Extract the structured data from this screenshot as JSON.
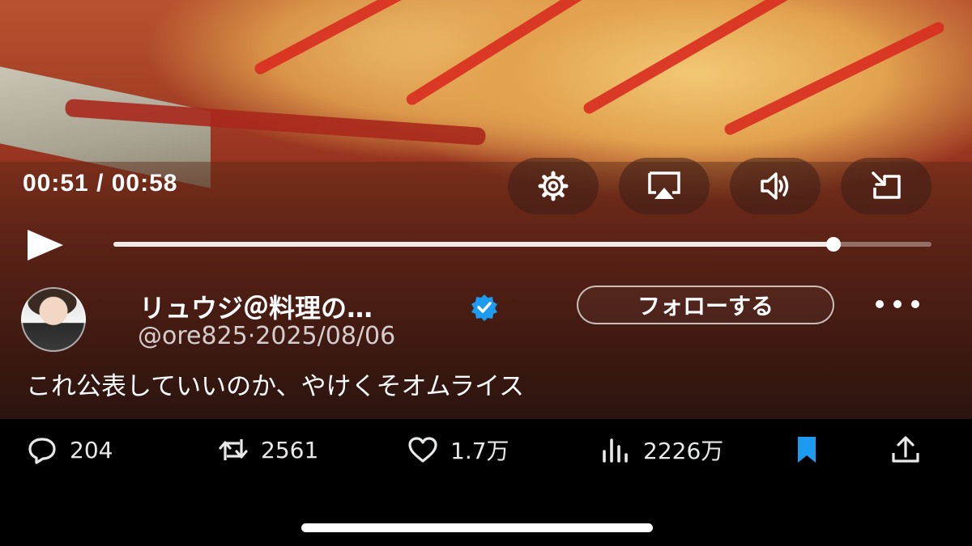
{
  "video": {
    "time_current": "00:51",
    "time_total": "00:58",
    "progress_fraction": 0.88,
    "controls": [
      {
        "name": "settings",
        "icon": "gear-icon"
      },
      {
        "name": "airplay",
        "icon": "airplay-icon"
      },
      {
        "name": "volume",
        "icon": "speaker-icon"
      },
      {
        "name": "pip",
        "icon": "pip-exit-icon"
      }
    ],
    "play_icon": "play-icon"
  },
  "post": {
    "display_name": "リュウジ＠料理の…",
    "verified": true,
    "handle": "@ore825",
    "separator": "·",
    "date": "2025/08/06",
    "follow_label": "フォローする",
    "more_icon": "ellipsis-icon",
    "text": "これ公表していいのか、やけくそオムライス"
  },
  "actions": {
    "replies": "204",
    "reposts": "2561",
    "likes": "1.7万",
    "views": "2226万",
    "bookmark_color": "#1d9bf0"
  }
}
